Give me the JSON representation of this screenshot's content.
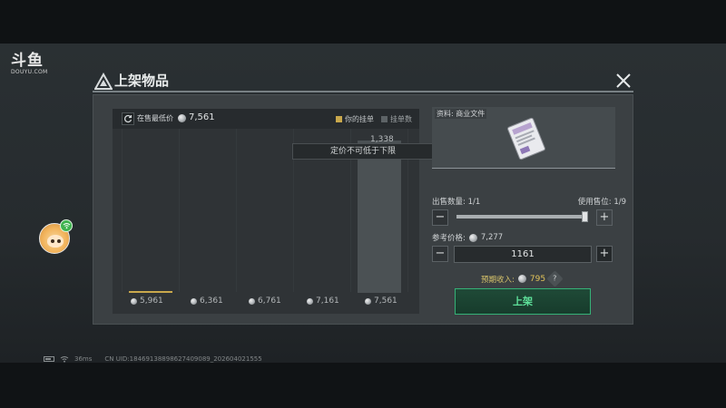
{
  "watermark": {
    "brand": "斗鱼",
    "domain": "DOUYU.COM"
  },
  "dialog": {
    "title": "上架物品"
  },
  "chart": {
    "min_price_label": "在售最低价",
    "min_price_value": "7,561",
    "legend_yours": "你的挂单",
    "legend_count": "挂单数",
    "tooltip": "定价不可低于下限",
    "top_bar_value": "1,338",
    "tick_labels": [
      "5,961",
      "6,361",
      "6,761",
      "7,161",
      "7,561"
    ]
  },
  "chart_data": {
    "type": "bar",
    "categories": [
      "5,961",
      "6,361",
      "6,761",
      "7,161",
      "7,561"
    ],
    "series": [
      {
        "name": "挂单数",
        "values": [
          0,
          0,
          0,
          0,
          1338
        ]
      },
      {
        "name": "你的挂单",
        "values": [
          1,
          0,
          0,
          0,
          0
        ]
      }
    ],
    "colors": {
      "count": "#4b5154",
      "yours": "#c9a84c"
    }
  },
  "item": {
    "label": "资料: 商业文件",
    "icon": "document-file-icon"
  },
  "sale": {
    "qty_label": "出售数量: 1/1",
    "slots_label": "使用售位: 1/9",
    "quantity_fraction": 1.0,
    "ref_price_label": "参考价格:",
    "ref_price_value": "7,277",
    "price_input_value": "1161",
    "income_label": "预期收入:",
    "income_value": "795",
    "help": "?",
    "submit_label": "上架",
    "minus": "−",
    "plus": "+"
  },
  "status_bar": {
    "ping": "36ms",
    "uid": "CN UID:18469138898627409089_202604021555"
  },
  "colors": {
    "accent_green": "#35b277",
    "gold": "#c9a84c",
    "panel": "#3b4043"
  }
}
